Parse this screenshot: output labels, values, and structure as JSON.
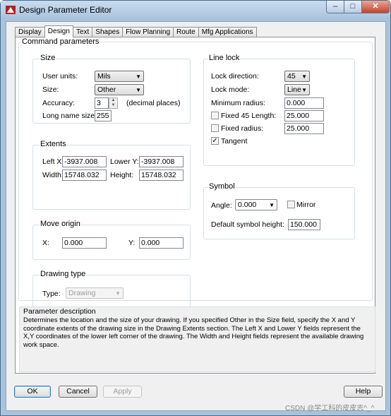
{
  "window": {
    "title": "Design Parameter Editor",
    "min": "–",
    "max": "□",
    "close": "✕"
  },
  "tabs": [
    "Display",
    "Design",
    "Text",
    "Shapes",
    "Flow Planning",
    "Route",
    "Mfg Applications"
  ],
  "active_tab": "Design",
  "command_parameters": {
    "title": "Command parameters"
  },
  "size": {
    "title": "Size",
    "user_units_label": "User units:",
    "user_units_value": "Mils",
    "size_label": "Size:",
    "size_value": "Other",
    "accuracy_label": "Accuracy:",
    "accuracy_value": "3",
    "accuracy_suffix": "(decimal places)",
    "long_name_label": "Long name size:",
    "long_name_value": "255"
  },
  "extents": {
    "title": "Extents",
    "left_x_label": "Left X:",
    "left_x_value": "-3937.008",
    "lower_y_label": "Lower Y:",
    "lower_y_value": "-3937.008",
    "width_label": "Width:",
    "width_value": "15748.032",
    "height_label": "Height:",
    "height_value": "15748.032"
  },
  "move_origin": {
    "title": "Move origin",
    "x_label": "X:",
    "x_value": "0.000",
    "y_label": "Y:",
    "y_value": "0.000"
  },
  "drawing_type": {
    "title": "Drawing type",
    "type_label": "Type:",
    "type_value": "Drawing"
  },
  "line_lock": {
    "title": "Line lock",
    "lock_direction_label": "Lock direction:",
    "lock_direction_value": "45",
    "lock_mode_label": "Lock mode:",
    "lock_mode_value": "Line",
    "min_radius_label": "Minimum radius:",
    "min_radius_value": "0.000",
    "fixed45_label": "Fixed 45 Length:",
    "fixed45_value": "25.000",
    "fixed45_checked": false,
    "fixed_radius_label": "Fixed radius:",
    "fixed_radius_value": "25.000",
    "fixed_radius_checked": false,
    "tangent_label": "Tangent",
    "tangent_checked": true
  },
  "symbol": {
    "title": "Symbol",
    "angle_label": "Angle:",
    "angle_value": "0.000",
    "mirror_label": "Mirror",
    "mirror_checked": false,
    "height_label": "Default symbol height:",
    "height_value": "150.000"
  },
  "description": {
    "title": "Parameter description",
    "text": "Determines the location and the size of your drawing. If you specified Other in the Size field, specify the X and Y coordinate extents of the drawing size in the Drawing Extents section. The Left X and Lower Y fields represent the X,Y coordinates of the lower left corner of the drawing. The Width and Height fields represent the available drawing work space."
  },
  "buttons": {
    "ok": "OK",
    "cancel": "Cancel",
    "apply": "Apply",
    "help": "Help"
  },
  "watermark": "CSDN @学工科的皮皮志^_^",
  "colors": {
    "titlebar": "#a9c3dc",
    "client": "#f0f0f0",
    "close": "#c4422b"
  }
}
